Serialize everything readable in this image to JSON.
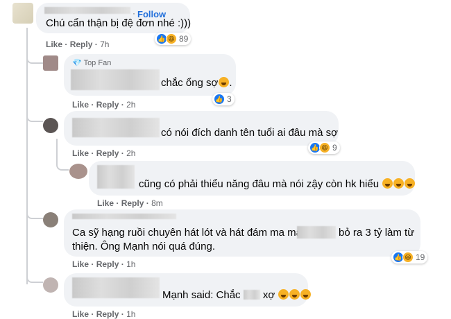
{
  "actions": {
    "like": "Like",
    "reply": "Reply",
    "separator": "·"
  },
  "colors": {
    "bubble": "#f0f2f5",
    "link": "#216fdb",
    "meta": "#65676b",
    "like": "#1877f2",
    "haha": "#f7b125"
  },
  "comments": [
    {
      "id": "c1",
      "header_follow": "Follow",
      "text": "Chú cẩn thận bị đệ đơn nhé :)))",
      "time": "7h",
      "reactions": [
        "like",
        "haha"
      ],
      "reaction_count": "89"
    },
    {
      "id": "c2",
      "badge": "Top Fan",
      "text": "chắc ổng sợ",
      "emoji_count": 1,
      "time": "2h",
      "reactions": [
        "like"
      ],
      "reaction_count": "3"
    },
    {
      "id": "c3",
      "text": "có nói đích danh tên tuổi ai đâu mà sợ",
      "time": "2h",
      "reactions": [
        "like",
        "haha"
      ],
      "reaction_count": "9"
    },
    {
      "id": "c4",
      "text": "cũng có phải thiểu năng đâu mà nói zậy còn hk hiểu",
      "emoji_count": 3,
      "time": "8m"
    },
    {
      "id": "c5",
      "text_line1_a": "Ca sỹ hạng ruồi chuyên hát lót và hát đám ma mà",
      "text_line1_b": "bỏ ra 3 tỷ làm từ",
      "text_line2": "thiện. Ông Mạnh nói quá đúng.",
      "time": "1h",
      "reactions": [
        "like",
        "haha"
      ],
      "reaction_count": "19"
    },
    {
      "id": "c6",
      "text_a": "Mạnh said: Chắc",
      "text_b": "xợ",
      "emoji_count": 3,
      "time": "1h"
    }
  ]
}
